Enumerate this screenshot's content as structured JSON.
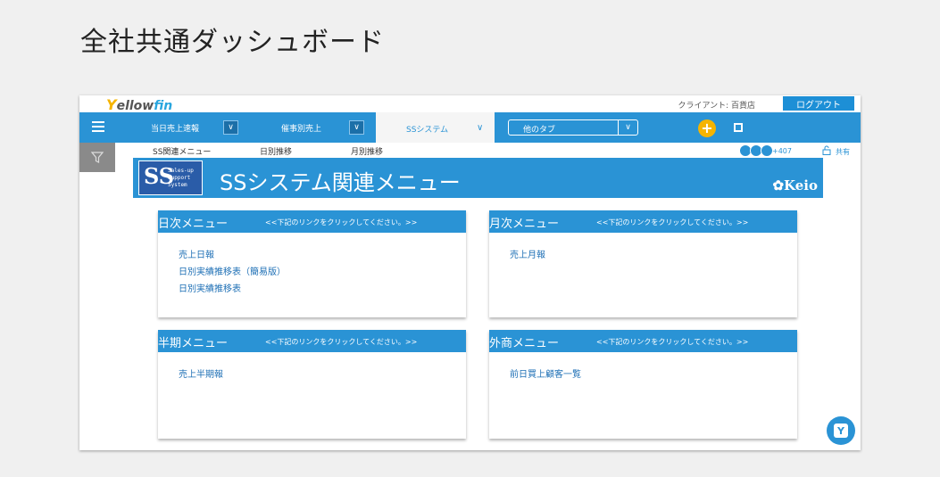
{
  "page": {
    "title": "全社共通ダッシュボード"
  },
  "topbar": {
    "logo_y": "Y",
    "logo_ellow": "ellow",
    "logo_fin": "fin",
    "client": "クライアント: 百貨店",
    "logout_label": "ログアウト"
  },
  "nav": {
    "tabs": [
      {
        "label": "当日売上速報"
      },
      {
        "label": "催事別売上"
      },
      {
        "label": "SSシステム"
      }
    ],
    "other_tabs_label": "他のタブ",
    "chevron": "∨"
  },
  "subtabs": [
    {
      "label": "SS関連メニュー"
    },
    {
      "label": "日別推移"
    },
    {
      "label": "月別推移"
    }
  ],
  "share": {
    "count": "+407",
    "label": "共有"
  },
  "banner": {
    "logo_letters": "SS",
    "logo_small": [
      "Sales-up",
      "Support",
      "System"
    ],
    "title": "SSシステム関連メニュー",
    "brand": "✿Keio"
  },
  "panels": [
    {
      "title": "日次メニュー",
      "note": "<<下記のリンクをクリックしてください。>>",
      "links": [
        "売上日報",
        "日別実績推移表（簡易版）",
        "日別実績推移表"
      ]
    },
    {
      "title": "月次メニュー",
      "note": "<<下記のリンクをクリックしてください。>>",
      "links": [
        "売上月報"
      ]
    },
    {
      "title": "半期メニュー",
      "note": "<<下記のリンクをクリックしてください。>>",
      "links": [
        "売上半期報"
      ]
    },
    {
      "title": "外商メニュー",
      "note": "<<下記のリンクをクリックしてください。>>",
      "links": [
        "前日買上顧客一覧"
      ]
    }
  ],
  "chat": {
    "icon_letter": "Y"
  },
  "colors": {
    "accent": "#2a93d5",
    "logo_yellow": "#f5b400",
    "plus": "#f5b400"
  }
}
